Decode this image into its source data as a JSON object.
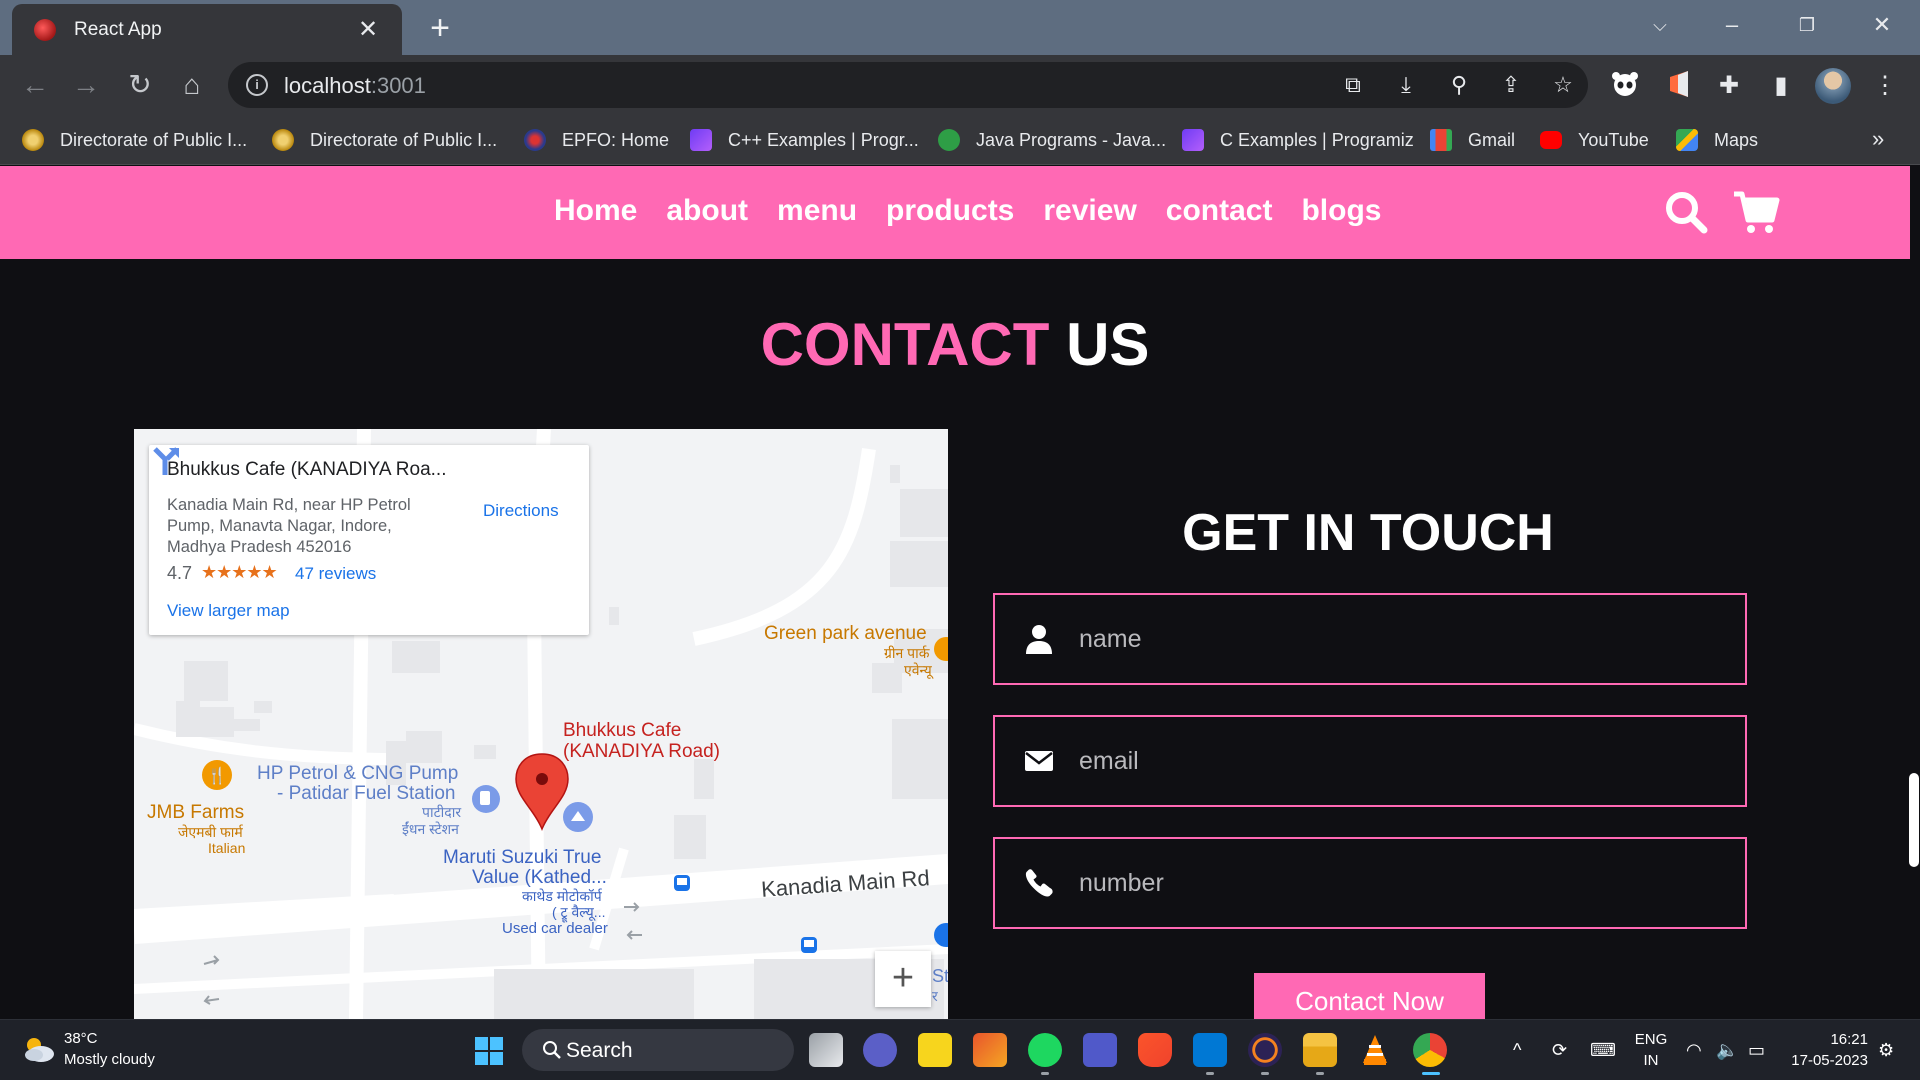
{
  "browser": {
    "tab_title": "React App",
    "new_tab_symbol": "+",
    "url_host": "localhost",
    "url_port": ":3001",
    "bookmarks": [
      {
        "label": "Directorate of Public I...",
        "color": "#c9a227"
      },
      {
        "label": "Directorate of Public I...",
        "color": "#c9a227"
      },
      {
        "label": "EPFO: Home",
        "color": "#3b4ca8"
      },
      {
        "label": "C++ Examples | Progr...",
        "color": "#6f3cf4"
      },
      {
        "label": "Java Programs - Java...",
        "color": "#2e9e46"
      },
      {
        "label": "C Examples | Programiz",
        "color": "#6f3cf4"
      },
      {
        "label": "Gmail",
        "color": "#ea4335"
      },
      {
        "label": "YouTube",
        "color": "#ff0000"
      },
      {
        "label": "Maps",
        "color": "#34a853"
      }
    ],
    "more_bookmarks": "»"
  },
  "site": {
    "nav": [
      "Home",
      "about",
      "menu",
      "products",
      "review",
      "contact",
      "blogs"
    ],
    "accent_color": "#ff69b4",
    "section_title": {
      "pink": "CONTACT",
      "white": "US"
    }
  },
  "map": {
    "place_name": "Bhukkus Cafe (KANADIYA Roa...",
    "address": "Kanadia Main Rd, near HP Petrol Pump, Manavta Nagar, Indore, Madhya Pradesh 452016",
    "rating": "4.7",
    "stars": "★★★★★",
    "reviews": "47 reviews",
    "view_larger": "View larger map",
    "directions": "Directions",
    "zoom_in": "+",
    "labels": {
      "marker_name_line1": "Bhukkus Cafe",
      "marker_name_line2": "(KANADIYA Road)",
      "green_park_en": "Green park avenue",
      "green_park_hi1": "ग्रीन पार्क",
      "green_park_hi2": "एवेन्यू",
      "hp_line1": "HP Petrol & CNG Pump",
      "hp_line2": "- Patidar Fuel Station",
      "hp_hi1": "पाटीदार",
      "hp_hi2": "ईंधन स्टेशन",
      "jmb_en": "JMB Farms",
      "jmb_hi": "जेएमबी फार्म",
      "jmb_type": "Italian",
      "maruti_line1": "Maruti Suzuki True",
      "maruti_line2": "Value (Kathed...",
      "maruti_hi1": "काथेड मोटोकॉर्प",
      "maruti_hi2": "( ट्रू वैल्यू...",
      "maruti_type": "Used car dealer",
      "road": "Kanadia Main Rd",
      "edge_st": "St",
      "edge_hi": "र"
    }
  },
  "contact_form": {
    "title": "GET IN TOUCH",
    "name_placeholder": "name",
    "email_placeholder": "email",
    "number_placeholder": "number",
    "submit_label": "Contact Now"
  },
  "taskbar": {
    "temperature": "38°C",
    "weather": "Mostly cloudy",
    "search_label": "Search",
    "lang_line1": "ENG",
    "lang_line2": "IN",
    "time": "16:21",
    "date": "17-05-2023",
    "tray_chevron": "^"
  }
}
